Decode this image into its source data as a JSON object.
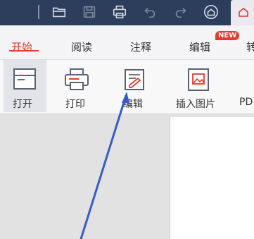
{
  "titlebar": {
    "buttons": [
      {
        "name": "open-folder-icon"
      },
      {
        "name": "save-icon"
      },
      {
        "name": "print-icon"
      },
      {
        "name": "undo-icon"
      },
      {
        "name": "redo-icon"
      },
      {
        "name": "home-icon"
      }
    ]
  },
  "tabs": {
    "start": "开始",
    "read": "阅读",
    "annotate": "注释",
    "edit": "编辑",
    "convert_partial": "转",
    "new_badge": "NEW"
  },
  "ribbon": {
    "open": "打开",
    "print": "打印",
    "edit": "编辑",
    "insert_image": "插入图片",
    "pdf_partial": "PD"
  },
  "colors": {
    "accent": "#e23b2e",
    "titlebar": "#2c3e5b",
    "arrow": "#3a5bc7"
  }
}
